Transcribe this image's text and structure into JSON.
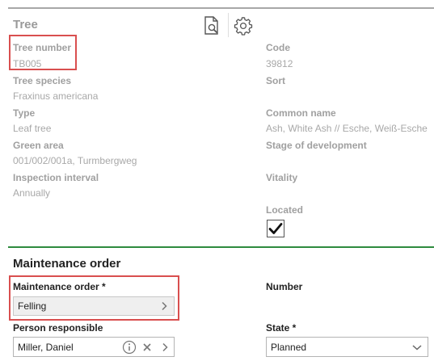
{
  "tree_section": {
    "title": "Tree",
    "fields": {
      "tree_number": {
        "label": "Tree number",
        "value": "TB005"
      },
      "code": {
        "label": "Code",
        "value": "39812"
      },
      "tree_species": {
        "label": "Tree species",
        "value": "Fraxinus americana"
      },
      "sort": {
        "label": "Sort",
        "value": ""
      },
      "type": {
        "label": "Type",
        "value": "Leaf tree"
      },
      "common_name": {
        "label": "Common name",
        "value": "Ash, White Ash // Esche, Weiß-Esche"
      },
      "green_area": {
        "label": "Green area",
        "value": "001/002/001a, Turmbergweg"
      },
      "stage_of_development": {
        "label": "Stage of development",
        "value": ""
      },
      "inspection_interval": {
        "label": "Inspection interval",
        "value": "Annually"
      },
      "vitality": {
        "label": "Vitality",
        "value": ""
      },
      "located": {
        "label": "Located",
        "checked": true
      }
    },
    "icons": [
      "document-search-icon",
      "gear-icon"
    ]
  },
  "maintenance_section": {
    "title": "Maintenance order",
    "maintenance_order": {
      "label": "Maintenance order *",
      "value": "Felling"
    },
    "number": {
      "label": "Number",
      "value": ""
    },
    "person_responsible": {
      "label": "Person responsible",
      "value": "Miller, Daniel"
    },
    "state": {
      "label": "State *",
      "value": "Planned"
    }
  },
  "colors": {
    "highlight_border": "#d94f4f",
    "section_divider": "#2e8b3e",
    "muted_text": "#a0a0a0"
  }
}
